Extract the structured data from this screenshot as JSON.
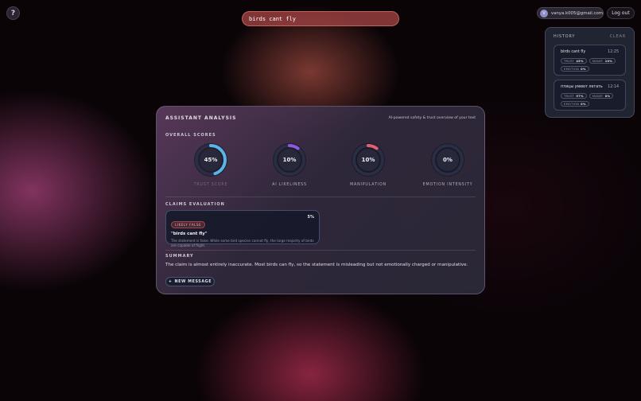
{
  "help": {
    "icon": "question-mark-icon",
    "glyph": "?"
  },
  "search": {
    "value": "birds cant fly"
  },
  "user": {
    "initial": "V",
    "email": "vanya.k005@gmail.com",
    "logout_label": "Log out"
  },
  "history": {
    "title": "HISTORY",
    "clear_label": "CLEAR",
    "items": [
      {
        "text": "birds cant fly",
        "time": "12:25",
        "tags": [
          {
            "label": "TRUST",
            "value": "45%"
          },
          {
            "label": "MANIP.",
            "value": "10%"
          },
          {
            "label": "EMOTION",
            "value": "0%"
          }
        ]
      },
      {
        "text": "птицы умеют летать",
        "time": "12:14",
        "tags": [
          {
            "label": "TRUST",
            "value": "97%"
          },
          {
            "label": "MANIP.",
            "value": "0%"
          },
          {
            "label": "EMOTION",
            "value": "0%"
          }
        ]
      }
    ]
  },
  "analysis": {
    "title": "ASSISTANT ANALYSIS",
    "subtitle": "AI-powered safety & trust overview of your text",
    "overall_label": "OVERALL SCORES",
    "scores": [
      {
        "label": "TRUST SCORE",
        "value": "45%",
        "fraction": 0.45,
        "color": "#5ab4e8"
      },
      {
        "label": "AI LIKELINESS",
        "value": "10%",
        "fraction": 0.1,
        "color": "#8a5ae0"
      },
      {
        "label": "MANIPULATION",
        "value": "10%",
        "fraction": 0.1,
        "color": "#e06070"
      },
      {
        "label": "EMOTION INTENSITY",
        "value": "0%",
        "fraction": 0.0,
        "color": "#c0c0d0"
      }
    ],
    "claims_label": "CLAIMS EVALUATION",
    "claim": {
      "badge": "LIKELY FALSE",
      "percent": "5%",
      "quote": "\"birds cant fly\"",
      "explanation": "The statement is false. While some bird species cannot fly, the large majority of birds are capable of flight."
    },
    "summary_label": "SUMMARY",
    "summary_text": "The claim is almost entirely inaccurate. Most birds can fly, so the statement is misleading but not emotionally charged or manipulative.",
    "new_message_label": "NEW MESSAGE",
    "new_message_icon": "plus-icon"
  }
}
